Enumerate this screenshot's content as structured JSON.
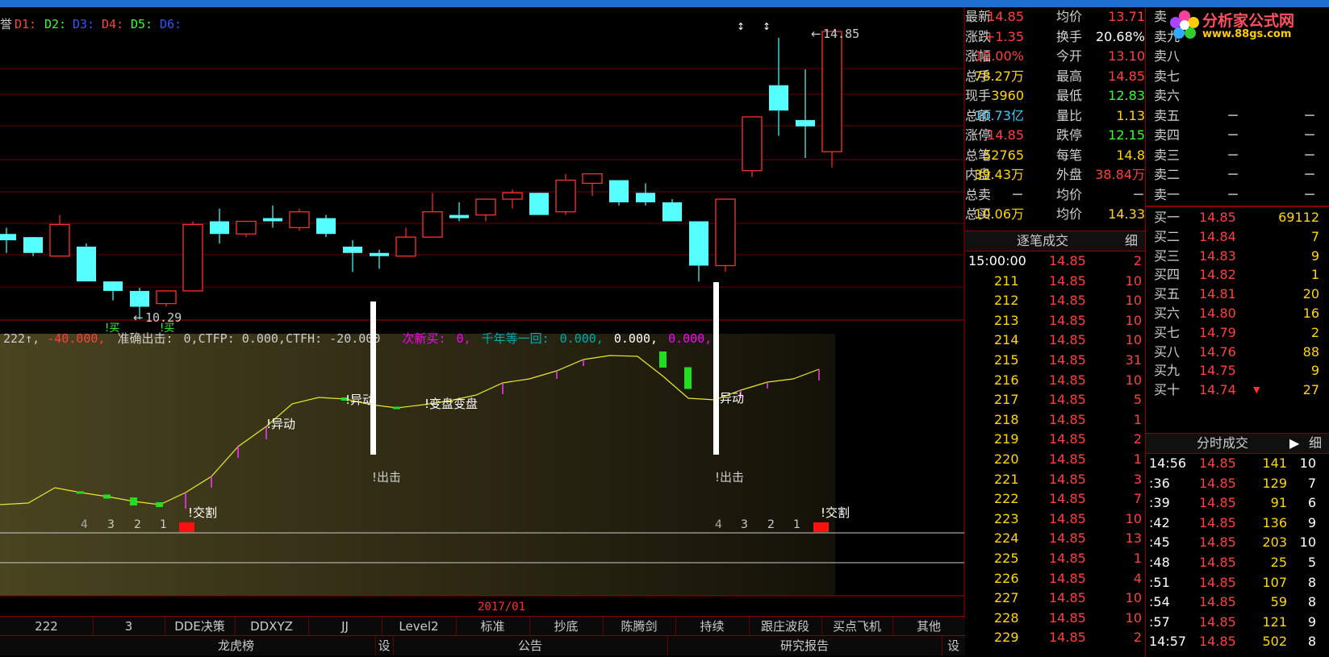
{
  "indicator_legend": {
    "ma_prefix": "誉",
    "d1": "D1:",
    "d2": "D2:",
    "d3": "D3:",
    "d4": "D4:",
    "d5": "D5:",
    "d6": "D6:"
  },
  "price_labels": {
    "high": "14.85",
    "low": "10.29"
  },
  "main_signals": {
    "buy1": "!买",
    "buy2": "!买"
  },
  "sub_indicator_line": {
    "p1": "222↑,",
    "p2": "-40.000,",
    "p3": "准确出击:",
    "p4": "0,CTFP: 0.000,CTFH: -20.000",
    "p5": "次新买:",
    "p6": "0,",
    "p7": "千年等一回:",
    "p8": "0.000,",
    "p9": "0.000,",
    "p10": "0.000,"
  },
  "sub_signals": {
    "yidong1": "!异动",
    "yidong2": "!异动",
    "yidong3": "!异动",
    "bianpan": "!变盘变盘",
    "chuji1": "!出击",
    "chuji2": "!出击",
    "jiaoge1": "!交割",
    "jiaoge2": "!交割",
    "c4a": "4",
    "c3a": "3",
    "c2a": "2",
    "c1a": "1",
    "c4b": "4",
    "c3b": "3",
    "c2b": "2",
    "c1b": "1"
  },
  "date_label": "2017/01",
  "tabs_row1": [
    "222",
    "3",
    "DDE决策",
    "DDXYZ",
    "JJ",
    "Level2",
    "标准",
    "抄底",
    "陈腾剑",
    "持续",
    "跟庄波段",
    "买点飞机",
    "其他"
  ],
  "tabs_row2": {
    "a": "龙虎榜",
    "a_set": "设",
    "b": "公告",
    "c": "研究报告",
    "c_set": "设"
  },
  "logo": {
    "title": "分析家公式网",
    "url": "www.88gs.com"
  },
  "quote": [
    {
      "l1": "最新",
      "v1": "14.85",
      "l2": "均价",
      "v2": "13.71"
    },
    {
      "l1": "涨跌",
      "v1": "+1.35",
      "l2": "换手",
      "v2": "20.68%"
    },
    {
      "l1": "涨幅",
      "v1": "10.00%",
      "l2": "今开",
      "v2": "13.10"
    },
    {
      "l1": "总手",
      "v1": "78.27万",
      "l2": "最高",
      "v2": "14.85"
    },
    {
      "l1": "现手",
      "v1": "3960",
      "l2": "最低",
      "v2": "12.83"
    },
    {
      "l1": "总额",
      "v1": "10.73亿",
      "l2": "量比",
      "v2": "1.13"
    },
    {
      "l1": "涨停",
      "v1": "14.85",
      "l2": "跌停",
      "v2": "12.15"
    },
    {
      "l1": "总笔",
      "v1": "52765",
      "l2": "每笔",
      "v2": "14.8"
    },
    {
      "l1": "内盘",
      "v1": "39.43万",
      "l2": "外盘",
      "v2": "38.84万"
    },
    {
      "l1": "总卖",
      "v1": "－",
      "l2": "均价",
      "v2": "－"
    },
    {
      "l1": "总买",
      "v1": "10.06万",
      "l2": "均价",
      "v2": "14.33"
    }
  ],
  "sell_orders": [
    {
      "label": "卖",
      "price": "",
      "vol": ""
    },
    {
      "label": "卖九",
      "price": "",
      "vol": ""
    },
    {
      "label": "卖八",
      "price": "",
      "vol": ""
    },
    {
      "label": "卖七",
      "price": "",
      "vol": ""
    },
    {
      "label": "卖六",
      "price": "",
      "vol": ""
    },
    {
      "label": "卖五",
      "price": "－",
      "vol": "－"
    },
    {
      "label": "卖四",
      "price": "－",
      "vol": "－"
    },
    {
      "label": "卖三",
      "price": "－",
      "vol": "－"
    },
    {
      "label": "卖二",
      "price": "－",
      "vol": "－"
    },
    {
      "label": "卖一",
      "price": "－",
      "vol": "－"
    }
  ],
  "buy_orders": [
    {
      "label": "买一",
      "price": "14.85",
      "vol": "69112"
    },
    {
      "label": "买二",
      "price": "14.84",
      "vol": "7"
    },
    {
      "label": "买三",
      "price": "14.83",
      "vol": "9"
    },
    {
      "label": "买四",
      "price": "14.82",
      "vol": "1"
    },
    {
      "label": "买五",
      "price": "14.81",
      "vol": "20"
    },
    {
      "label": "买六",
      "price": "14.80",
      "vol": "16"
    },
    {
      "label": "买七",
      "price": "14.79",
      "vol": "2"
    },
    {
      "label": "买八",
      "price": "14.76",
      "vol": "88"
    },
    {
      "label": "买九",
      "price": "14.75",
      "vol": "9"
    },
    {
      "label": "买十",
      "price": "14.74",
      "vol": "27"
    }
  ],
  "tick_header": {
    "title": "逐笔成交",
    "btn": "细"
  },
  "ticks": [
    {
      "t": "15:00:00",
      "p": "14.85",
      "v": "2"
    },
    {
      "t": "211",
      "p": "14.85",
      "v": "10"
    },
    {
      "t": "212",
      "p": "14.85",
      "v": "10"
    },
    {
      "t": "213",
      "p": "14.85",
      "v": "10"
    },
    {
      "t": "214",
      "p": "14.85",
      "v": "10"
    },
    {
      "t": "215",
      "p": "14.85",
      "v": "31"
    },
    {
      "t": "216",
      "p": "14.85",
      "v": "10"
    },
    {
      "t": "217",
      "p": "14.85",
      "v": "5"
    },
    {
      "t": "218",
      "p": "14.85",
      "v": "1"
    },
    {
      "t": "219",
      "p": "14.85",
      "v": "2"
    },
    {
      "t": "220",
      "p": "14.85",
      "v": "1"
    },
    {
      "t": "221",
      "p": "14.85",
      "v": "3"
    },
    {
      "t": "222",
      "p": "14.85",
      "v": "7"
    },
    {
      "t": "223",
      "p": "14.85",
      "v": "10"
    },
    {
      "t": "224",
      "p": "14.85",
      "v": "13"
    },
    {
      "t": "225",
      "p": "14.85",
      "v": "1"
    },
    {
      "t": "226",
      "p": "14.85",
      "v": "4"
    },
    {
      "t": "227",
      "p": "14.85",
      "v": "10"
    },
    {
      "t": "228",
      "p": "14.85",
      "v": "10"
    },
    {
      "t": "229",
      "p": "14.85",
      "v": "2"
    }
  ],
  "minute_header": {
    "title": "分时成交",
    "btn": "细"
  },
  "minute_ticks": [
    {
      "t": "14:56",
      "p": "14.85",
      "v": "141",
      "n": "10"
    },
    {
      "t": ":36",
      "p": "14.85",
      "v": "129",
      "n": "7"
    },
    {
      "t": ":39",
      "p": "14.85",
      "v": "91",
      "n": "6"
    },
    {
      "t": ":42",
      "p": "14.85",
      "v": "136",
      "n": "9"
    },
    {
      "t": ":45",
      "p": "14.85",
      "v": "203",
      "n": "10"
    },
    {
      "t": ":48",
      "p": "14.85",
      "v": "25",
      "n": "5"
    },
    {
      "t": ":51",
      "p": "14.85",
      "v": "107",
      "n": "8"
    },
    {
      "t": ":54",
      "p": "14.85",
      "v": "59",
      "n": "8"
    },
    {
      "t": ":57",
      "p": "14.85",
      "v": "121",
      "n": "9"
    },
    {
      "t": "14:57",
      "p": "14.85",
      "v": "502",
      "n": "8"
    }
  ],
  "candles": [
    {
      "o": 11.65,
      "c": 11.55,
      "h": 11.75,
      "l": 11.35
    },
    {
      "o": 11.6,
      "c": 11.35,
      "h": 11.6,
      "l": 11.3
    },
    {
      "o": 11.3,
      "c": 11.8,
      "h": 11.95,
      "l": 11.3
    },
    {
      "o": 11.45,
      "c": 10.9,
      "h": 11.5,
      "l": 10.9
    },
    {
      "o": 10.9,
      "c": 10.75,
      "h": 10.9,
      "l": 10.6
    },
    {
      "o": 10.75,
      "c": 10.5,
      "h": 10.8,
      "l": 10.3
    },
    {
      "o": 10.55,
      "c": 10.75,
      "h": 10.75,
      "l": 10.5
    },
    {
      "o": 10.75,
      "c": 11.8,
      "h": 11.85,
      "l": 10.75
    },
    {
      "o": 11.85,
      "c": 11.65,
      "h": 12.05,
      "l": 11.5
    },
    {
      "o": 11.65,
      "c": 11.85,
      "h": 11.85,
      "l": 11.6
    },
    {
      "o": 11.9,
      "c": 11.85,
      "h": 12.1,
      "l": 11.75
    },
    {
      "o": 11.75,
      "c": 12.0,
      "h": 12.05,
      "l": 11.7
    },
    {
      "o": 11.9,
      "c": 11.65,
      "h": 11.95,
      "l": 11.6
    },
    {
      "o": 11.45,
      "c": 11.35,
      "h": 11.55,
      "l": 11.05
    },
    {
      "o": 11.35,
      "c": 11.3,
      "h": 11.4,
      "l": 11.1
    },
    {
      "o": 11.3,
      "c": 11.6,
      "h": 11.75,
      "l": 11.3
    },
    {
      "o": 11.6,
      "c": 12.0,
      "h": 12.3,
      "l": 11.6
    },
    {
      "o": 11.95,
      "c": 11.9,
      "h": 12.15,
      "l": 11.85
    },
    {
      "o": 11.95,
      "c": 12.2,
      "h": 12.2,
      "l": 11.85
    },
    {
      "o": 12.2,
      "c": 12.3,
      "h": 12.35,
      "l": 12.05
    },
    {
      "o": 12.3,
      "c": 11.95,
      "h": 12.3,
      "l": 11.95
    },
    {
      "o": 12.0,
      "c": 12.5,
      "h": 12.6,
      "l": 11.95
    },
    {
      "o": 12.45,
      "c": 12.6,
      "h": 12.6,
      "l": 12.25
    },
    {
      "o": 12.5,
      "c": 12.15,
      "h": 12.5,
      "l": 12.1
    },
    {
      "o": 12.3,
      "c": 12.15,
      "h": 12.45,
      "l": 12.1
    },
    {
      "o": 12.15,
      "c": 11.85,
      "h": 12.2,
      "l": 11.85
    },
    {
      "o": 11.85,
      "c": 11.15,
      "h": 11.85,
      "l": 10.9
    },
    {
      "o": 11.15,
      "c": 12.2,
      "h": 12.2,
      "l": 11.05
    },
    {
      "o": 12.65,
      "c": 13.5,
      "h": 13.5,
      "l": 12.55
    },
    {
      "o": 14.0,
      "c": 13.6,
      "h": 14.75,
      "l": 13.2
    },
    {
      "o": 13.45,
      "c": 13.35,
      "h": 14.25,
      "l": 12.85
    },
    {
      "o": 12.95,
      "c": 14.85,
      "h": 14.85,
      "l": 12.7
    }
  ]
}
